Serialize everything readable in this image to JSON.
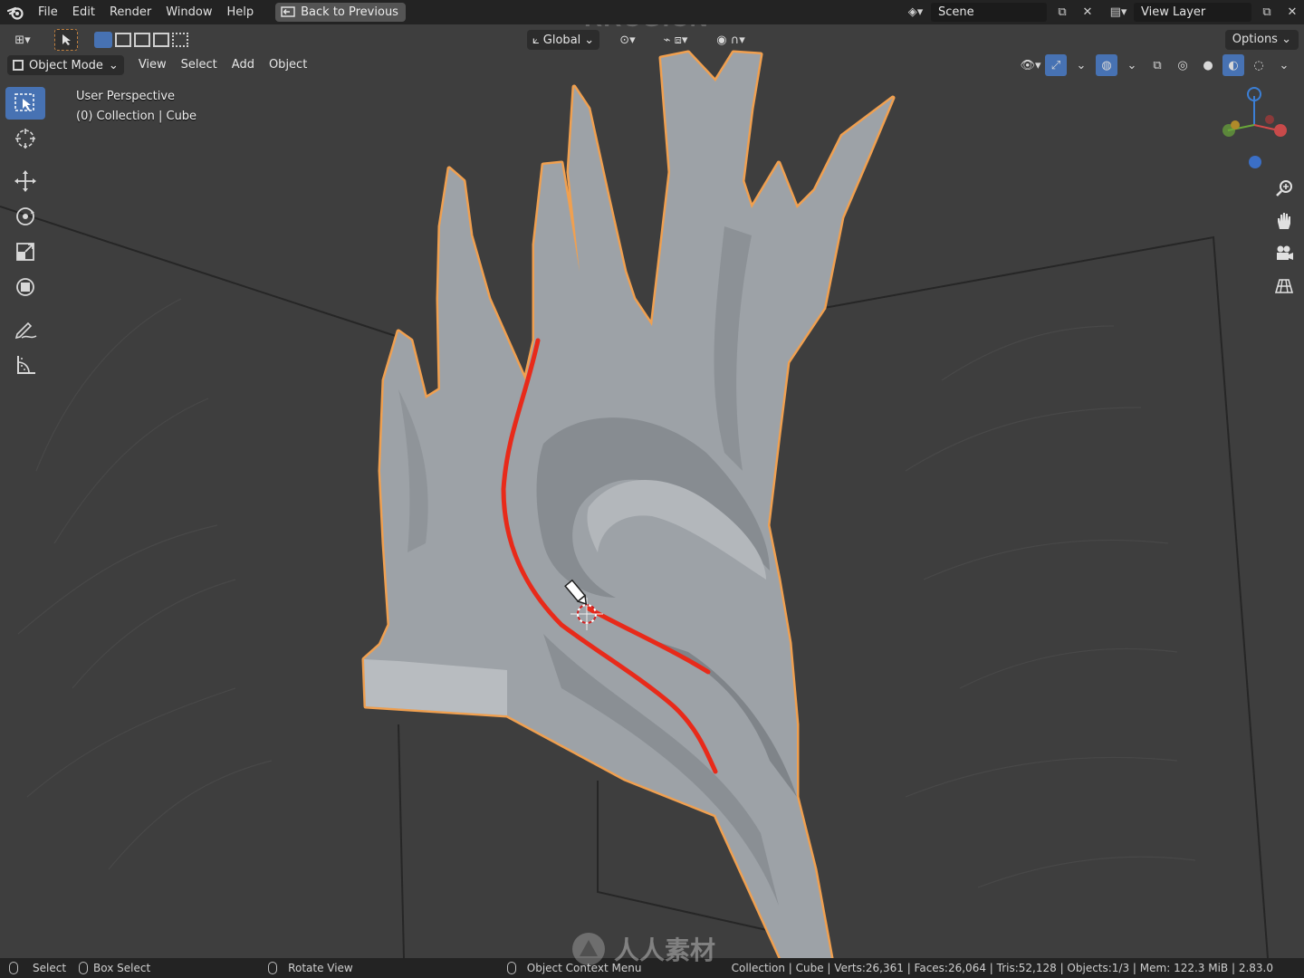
{
  "menu": {
    "items": [
      "File",
      "Edit",
      "Render",
      "Window",
      "Help"
    ],
    "back_button": "Back to Previous",
    "watermark": "RRCG.CN"
  },
  "scene": {
    "label": "Scene",
    "view_layer": "View Layer"
  },
  "header": {
    "orientation": "Global",
    "options": "Options"
  },
  "mode_row": {
    "mode": "Object Mode",
    "menus": [
      "View",
      "Select",
      "Add",
      "Object"
    ]
  },
  "viewport": {
    "perspective": "User Perspective",
    "collection": "(0) Collection | Cube"
  },
  "statusbar": {
    "select": "Select",
    "box_select": "Box Select",
    "rotate_view": "Rotate View",
    "context_menu": "Object Context Menu",
    "stats": "Collection | Cube | Verts:26,361 | Faces:26,064 | Tris:52,128 | Objects:1/3 | Mem: 122.3 MiB | 2.83.0",
    "watermark": "人人素材"
  },
  "colors": {
    "accent": "#4772b3",
    "outline": "#f0a050",
    "stroke": "#e82a1a",
    "mesh": "#9aa0a6"
  },
  "icons": {
    "tools": [
      "select-box-icon",
      "cursor-icon",
      "move-icon",
      "rotate-icon",
      "scale-icon",
      "transform-icon",
      "annotate-icon",
      "measure-icon"
    ],
    "nav": [
      "zoom-icon",
      "pan-hand-icon",
      "camera-icon",
      "grid-ortho-icon"
    ]
  }
}
